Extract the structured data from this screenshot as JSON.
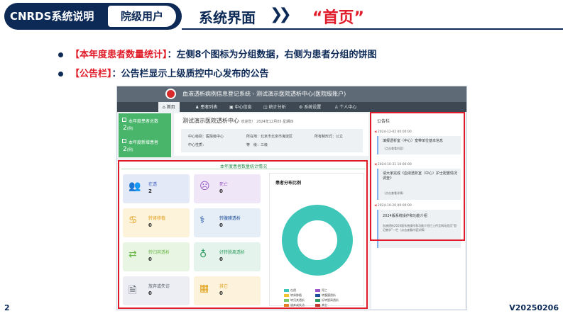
{
  "header": {
    "left_label": "CNRDS系统说明",
    "role_label": "院级用户",
    "section_title": "系统界面",
    "arrows": "❯❯",
    "page_name": "“首页”"
  },
  "bullets": [
    {
      "tag": "【本年度患者数量统计】",
      "text": "：左侧8个图标为分组数据，右侧为患者分组的饼图"
    },
    {
      "tag": "【公告栏】",
      "text": "：公告栏显示上级质控中心发布的公告"
    }
  ],
  "app": {
    "title": "血液透析病例信息登记系统 - 测试演示医院透析中心(医院级账户)",
    "nav": [
      "首页",
      "患者列表",
      "中心信息",
      "统计分析",
      "系统设置",
      "个人中心"
    ],
    "left_panel": [
      {
        "label": "本年度患者总数",
        "value": "2",
        "unit": "(例)"
      },
      {
        "label": "本年度新增患者",
        "value": "2",
        "unit": "(例)"
      }
    ],
    "info": {
      "center_name": "测试演示医院透析中心",
      "welcome": "欢迎您！ 2024年12月05 星期四",
      "level_label": "中心级别：",
      "level_value": "医院级中心",
      "location_label": "所在地：",
      "location_value": "北京市北京市海淀区",
      "owner_label": "所有制形式：",
      "owner_value": "公立",
      "nature_label": "中心性质：",
      "nature_value": "",
      "grade_label": "等　级：",
      "grade_value": "三级"
    },
    "announcements": {
      "title": "公告栏",
      "items": [
        {
          "date": "2024-12-02 00:00:00",
          "text": "填报透析室（中心）宽带单位基本信息",
          "sub": "（点击查看内容）"
        },
        {
          "date": "2024-10-31 10:00:00",
          "text": "请大家完成《血液透析室（中心）护士配置情况调查》",
          "sub": "（点击查看详情）"
        },
        {
          "date": "2024-10-20 00:00:00",
          "text": "2024版系统操作和功能介绍",
          "sub": "血液透析2024版系统操作和功能介绍已上传至网站首页“登记教学”一栏（点击查看内容详情）"
        }
      ]
    },
    "stats": {
      "title": "本年度患者数量统计情况",
      "tiles": [
        {
          "label": "在透",
          "value": "2",
          "color": "#e3e9f7",
          "text_color": "#3b5ec6",
          "icon": "users-icon"
        },
        {
          "label": "死亡",
          "value": "0",
          "color": "#efe6f7",
          "text_color": "#9a58c9",
          "icon": "sad-face-icon"
        },
        {
          "label": "转肾移植",
          "value": "0",
          "color": "#fdf2da",
          "text_color": "#e2a11b",
          "icon": "kidney-icon"
        },
        {
          "label": "转腹膜透析",
          "value": "0",
          "color": "#e5edf7",
          "text_color": "#1b4e9c",
          "icon": "dialysis-icon"
        },
        {
          "label": "转归其透析",
          "value": "0",
          "color": "#e8f5e3",
          "text_color": "#6ab84a",
          "icon": "swap-icon"
        },
        {
          "label": "好转脱离透析",
          "value": "0",
          "color": "#e4f4ec",
          "text_color": "#2f9c61",
          "icon": "stethoscope-icon"
        },
        {
          "label": "放弃或失访",
          "value": "0",
          "color": "#eceef3",
          "text_color": "#555b66",
          "icon": "document-x-icon"
        },
        {
          "label": "其它",
          "value": "0",
          "color": "#fdf3dc",
          "text_color": "#e2a11b",
          "icon": "grid-icon"
        }
      ]
    },
    "pie": {
      "title": "患者分布比例",
      "legend": [
        {
          "name": "在透",
          "color": "#3ec7b8"
        },
        {
          "name": "死亡",
          "color": "#9a58c9"
        },
        {
          "name": "转肾移植",
          "color": "#f1c232"
        },
        {
          "name": "转腹膜透析",
          "color": "#1b4e9c"
        },
        {
          "name": "转归其透析",
          "color": "#7cc86a"
        },
        {
          "name": "好转脱离透析",
          "color": "#2f9c61"
        },
        {
          "name": "放弃或失访",
          "color": "#e67e22"
        },
        {
          "name": "其它",
          "color": "#c0392b"
        }
      ],
      "values": [
        2,
        0,
        0,
        0,
        0,
        0,
        0,
        0
      ]
    }
  },
  "footer": {
    "page_number": "2",
    "version": "V20250206"
  }
}
